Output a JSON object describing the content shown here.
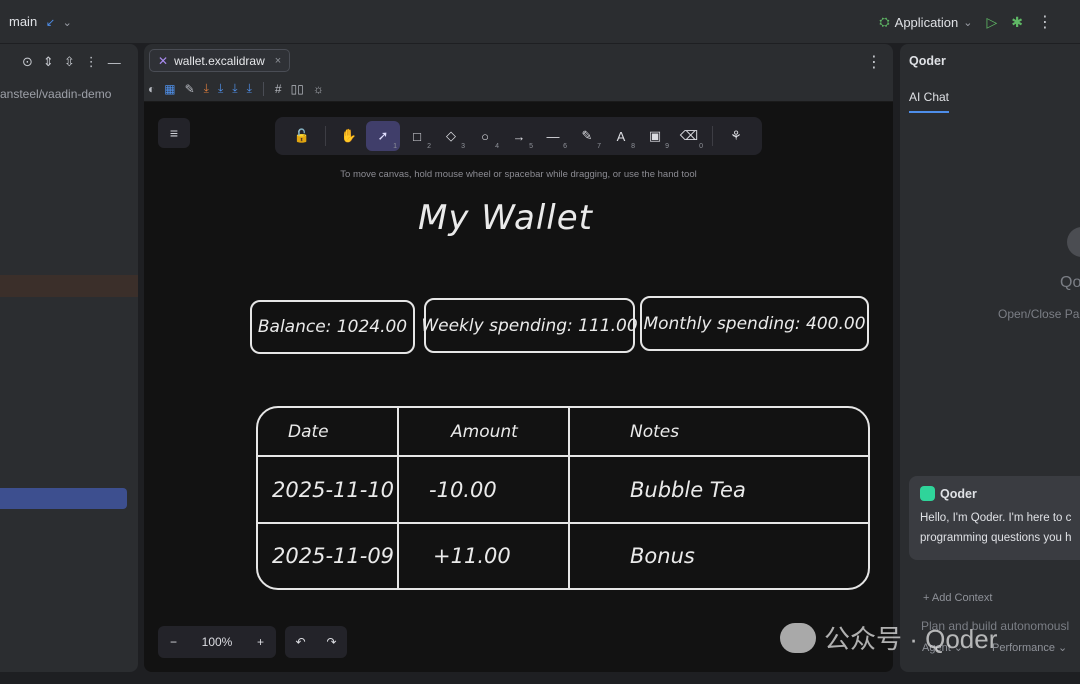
{
  "topbar": {
    "branch": "main",
    "branch_arrow": "↙",
    "run_config": "Application",
    "more": "⋮"
  },
  "left_panel": {
    "project_path": "ansteel/vaadin-demo",
    "tools": [
      "⊙",
      "⇕",
      "⇳",
      "⋮",
      "—"
    ]
  },
  "editor": {
    "tab_label": "wallet.excalidraw",
    "tab_close": "×",
    "more": "⋮"
  },
  "excalidraw": {
    "menu_icon": "≡",
    "tools": [
      {
        "icon": "🔓",
        "num": ""
      },
      {
        "icon": "✋",
        "num": ""
      },
      {
        "icon": "➚",
        "num": "1"
      },
      {
        "icon": "□",
        "num": "2"
      },
      {
        "icon": "◇",
        "num": "3"
      },
      {
        "icon": "○",
        "num": "4"
      },
      {
        "icon": "→",
        "num": "5"
      },
      {
        "icon": "—",
        "num": "6"
      },
      {
        "icon": "✎",
        "num": "7"
      },
      {
        "icon": "A",
        "num": "8"
      },
      {
        "icon": "▣",
        "num": "9"
      },
      {
        "icon": "⌫",
        "num": "0"
      },
      {
        "icon": "⚘",
        "num": ""
      }
    ],
    "hint": "To move canvas, hold mouse wheel or spacebar while dragging, or use the hand tool",
    "zoom_out": "−",
    "zoom_level": "100%",
    "zoom_in": "+",
    "undo": "↶",
    "redo": "↷"
  },
  "drawing": {
    "title": "My Wallet",
    "cards": [
      "Balance: 1024.00",
      "Weekly spending: 111.00",
      "Monthly spending: 400.00"
    ],
    "table": {
      "headers": [
        "Date",
        "Amount",
        "Notes"
      ],
      "rows": [
        [
          "2025-11-10",
          "-10.00",
          "Bubble Tea"
        ],
        [
          "2025-11-09",
          "+11.00",
          "Bonus"
        ]
      ]
    }
  },
  "right_panel": {
    "title": "Qoder",
    "tab": "AI Chat",
    "placeholder_name": "Qo",
    "open_close": "Open/Close Pa",
    "message_author": "Qoder",
    "message_line1": "Hello, I'm Qoder. I'm here to c",
    "message_line2": "programming questions you h",
    "add_context": "+ Add Context",
    "plan_text": "Plan and build autonomousl",
    "agent_label": "Agent ⌄",
    "performance_label": "Performance ⌄"
  },
  "watermark": "公众号 · Qoder"
}
